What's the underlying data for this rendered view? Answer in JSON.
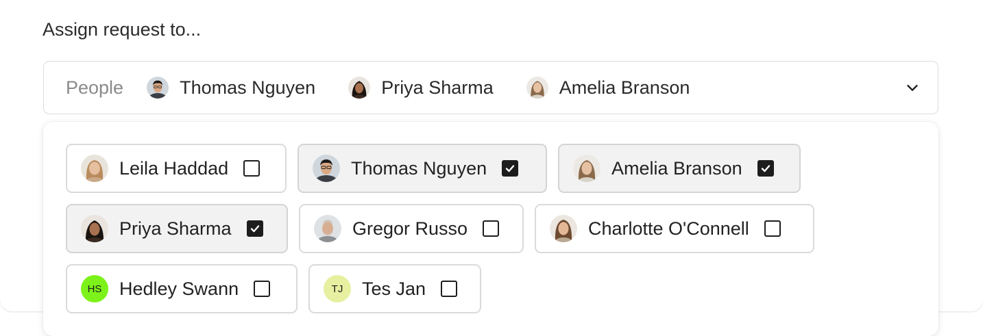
{
  "form": {
    "label": "Assign request to..."
  },
  "select": {
    "placeholder": "People",
    "selected": [
      {
        "name": "Thomas Nguyen",
        "avatar": "photo-thomas"
      },
      {
        "name": "Priya Sharma",
        "avatar": "photo-priya"
      },
      {
        "name": "Amelia Branson",
        "avatar": "photo-amelia"
      }
    ],
    "toggle_icon": "chevron-down-icon"
  },
  "options": [
    {
      "name": "Leila Haddad",
      "checked": false,
      "avatar": "photo-leila"
    },
    {
      "name": "Thomas Nguyen",
      "checked": true,
      "avatar": "photo-thomas"
    },
    {
      "name": "Amelia Branson",
      "checked": true,
      "avatar": "photo-amelia"
    },
    {
      "name": "Priya Sharma",
      "checked": true,
      "avatar": "photo-priya"
    },
    {
      "name": "Gregor Russo",
      "checked": false,
      "avatar": "photo-gregor"
    },
    {
      "name": "Charlotte O'Connell",
      "checked": false,
      "avatar": "photo-charlotte"
    },
    {
      "name": "Hedley Swann",
      "checked": false,
      "initials": "HS",
      "color": "#7cf21a"
    },
    {
      "name": "Tes Jan",
      "checked": false,
      "initials": "TJ",
      "color": "#e6f0a0"
    }
  ],
  "colors": {
    "checkbox": "#1d1d1d",
    "checked_bg": "#f2f2f2",
    "border": "#dadada"
  }
}
